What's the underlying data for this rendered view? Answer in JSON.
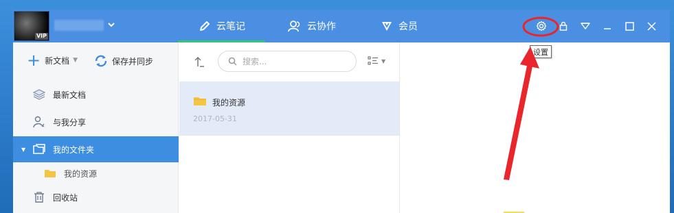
{
  "header": {
    "avatar_badge": "VIP",
    "user_menu_icon": "chevron-down-icon",
    "tabs": [
      {
        "label": "云笔记",
        "icon": "pencil-icon",
        "active": true
      },
      {
        "label": "云协作",
        "icon": "users-icon",
        "active": false
      },
      {
        "label": "会员",
        "icon": "vip-diamond-icon",
        "active": false
      }
    ],
    "controls": [
      {
        "name": "settings",
        "icon": "gear-icon",
        "tooltip": "设置"
      },
      {
        "name": "lock",
        "icon": "lock-icon"
      },
      {
        "name": "menu",
        "icon": "triangle-down-icon"
      },
      {
        "name": "minimize",
        "icon": "minimize-icon"
      },
      {
        "name": "maximize",
        "icon": "maximize-icon"
      },
      {
        "name": "close",
        "icon": "close-icon"
      }
    ]
  },
  "sidebar": {
    "new_doc_label": "新文档",
    "sync_label": "保存并同步",
    "items": [
      {
        "label": "最新文档",
        "icon": "layers-icon"
      },
      {
        "label": "与我分享",
        "icon": "share-user-icon"
      },
      {
        "label": "我的文件夹",
        "icon": "folder-outline-icon",
        "active": true,
        "expanded": true
      },
      {
        "label": "我的资源",
        "icon": "folder-icon",
        "sub": true
      },
      {
        "label": "回收站",
        "icon": "trash-icon"
      }
    ]
  },
  "list": {
    "search_placeholder": "搜索...",
    "items": [
      {
        "title": "我的资源",
        "date": "2017-05-31",
        "icon": "folder-icon",
        "selected": true
      }
    ]
  },
  "colors": {
    "header": "#4b8fe3",
    "active_item": "#3d8de0",
    "tab_underline": "#37c57a",
    "selected_row": "#e3ebf8",
    "annotation_red": "#e8262b",
    "folder": "#f4c542"
  }
}
